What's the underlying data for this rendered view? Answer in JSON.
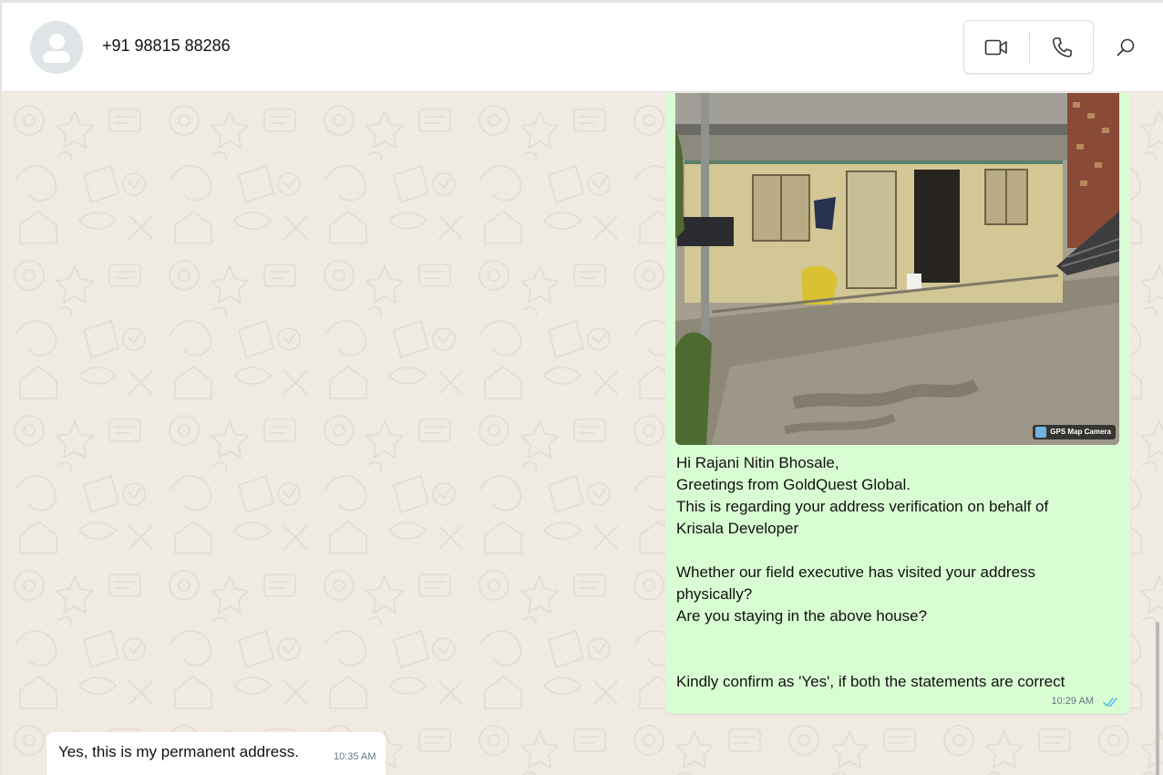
{
  "header": {
    "contact_name": "+91 98815 88286",
    "icons": [
      "avatar-placeholder",
      "video-call-icon",
      "voice-call-icon",
      "search-icon"
    ]
  },
  "messages": {
    "outgoing": {
      "image": {
        "watermark": "GPS Map Camera"
      },
      "lines": [
        "Hi Rajani Nitin Bhosale,",
        "Greetings from GoldQuest Global.",
        "This is regarding your address verification on behalf of",
        "Krisala Developer",
        "",
        "Whether our field executive has visited your address",
        "physically?",
        "Are you staying in the above house?",
        "",
        "",
        "Kindly confirm as 'Yes', if both the statements are correct"
      ],
      "time": "10:29 AM",
      "status": "read"
    },
    "incoming": {
      "text": "Yes, this is my permanent address.",
      "time": "10:35 AM"
    }
  },
  "colors": {
    "outgoing_bubble": "#d9fdd3",
    "incoming_bubble": "#ffffff",
    "chat_background": "#efeae2",
    "read_ticks": "#53bdeb"
  }
}
